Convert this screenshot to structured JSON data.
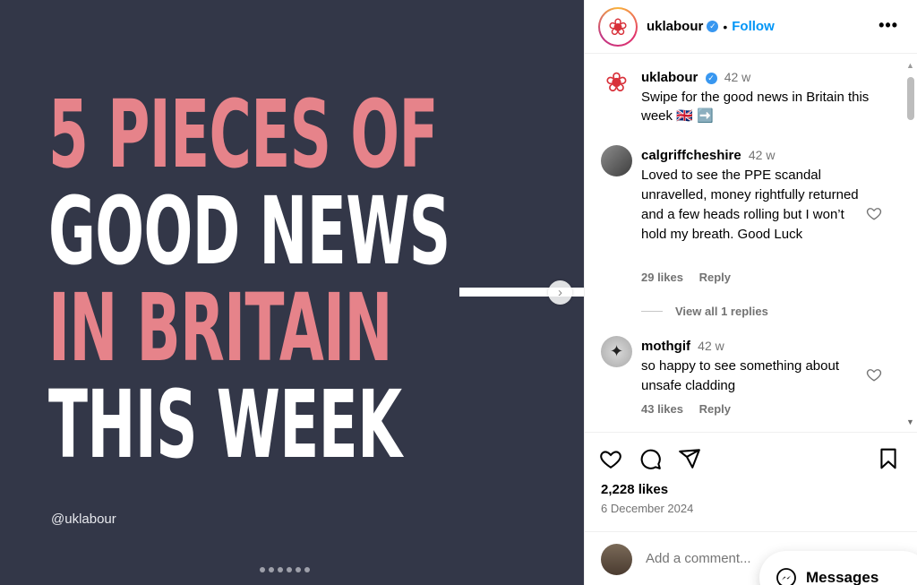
{
  "post_image": {
    "headline": [
      {
        "text": "5 PIECES OF",
        "tone": "pink"
      },
      {
        "text": "GOOD NEWS",
        "tone": "white"
      },
      {
        "text": "IN BRITAIN",
        "tone": "pink"
      },
      {
        "text": "THIS WEEK",
        "tone": "white"
      }
    ],
    "handle": "@uklabour",
    "background_color": "#333748",
    "accent_color": "#e6838a",
    "next_icon": "chevron-right-icon",
    "carousel_dots": 6
  },
  "header": {
    "username": "uklabour",
    "separator": "•",
    "follow_label": "Follow",
    "more_icon": "more-icon"
  },
  "caption": {
    "username": "uklabour",
    "time": "42 w",
    "text": "Swipe for the good news in Britain this week 🇬🇧 ➡️"
  },
  "comments": [
    {
      "username": "calgriffcheshire",
      "time": "42 w",
      "text": "Loved to see the PPE scandal unravelled, money rightfully returned and a few heads rolling but I won’t hold my breath. Good Luck",
      "likes": "29 likes",
      "reply": "Reply"
    },
    {
      "username": "mothgif",
      "time": "42 w",
      "text": "so happy to see something about unsafe cladding",
      "likes": "43 likes",
      "reply": "Reply"
    }
  ],
  "view_replies": "View all 1 replies",
  "actions": {
    "likes_count": "2,228 likes",
    "date": "6 December 2024",
    "add_comment_placeholder": "Add a comment..."
  },
  "messages_label": "Messages",
  "colors": {
    "link_blue": "#0095f6",
    "verified_blue": "#3897f0",
    "secondary_text": "#737373"
  }
}
